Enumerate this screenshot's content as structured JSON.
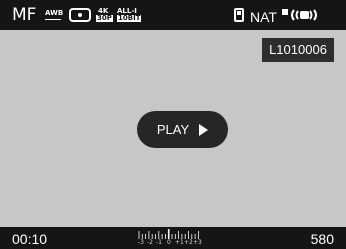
{
  "top_bar": {
    "mode": "MF",
    "awb": "AWB",
    "metering_label": "(•)",
    "format_badge": {
      "line1": "4K",
      "line2": "30P"
    },
    "all_i_badge": {
      "line1": "ALL-I",
      "line2": "10BIT"
    },
    "picture_style": "NAT",
    "stabilization": "IS"
  },
  "file_label": "L1010006",
  "play_button": {
    "label": "PLAY",
    "icon": "triangle-right-icon"
  },
  "bottom_bar": {
    "time": "00:10",
    "remaining": "580",
    "exposure_scale": [
      "-3",
      "-2",
      "-1",
      "0",
      "+1",
      "+2",
      "+3"
    ]
  },
  "colors": {
    "bar_bg": "#151515",
    "screen_bg": "#c7c7c7",
    "overlay_bg": "#262626",
    "text": "#ffffff"
  }
}
